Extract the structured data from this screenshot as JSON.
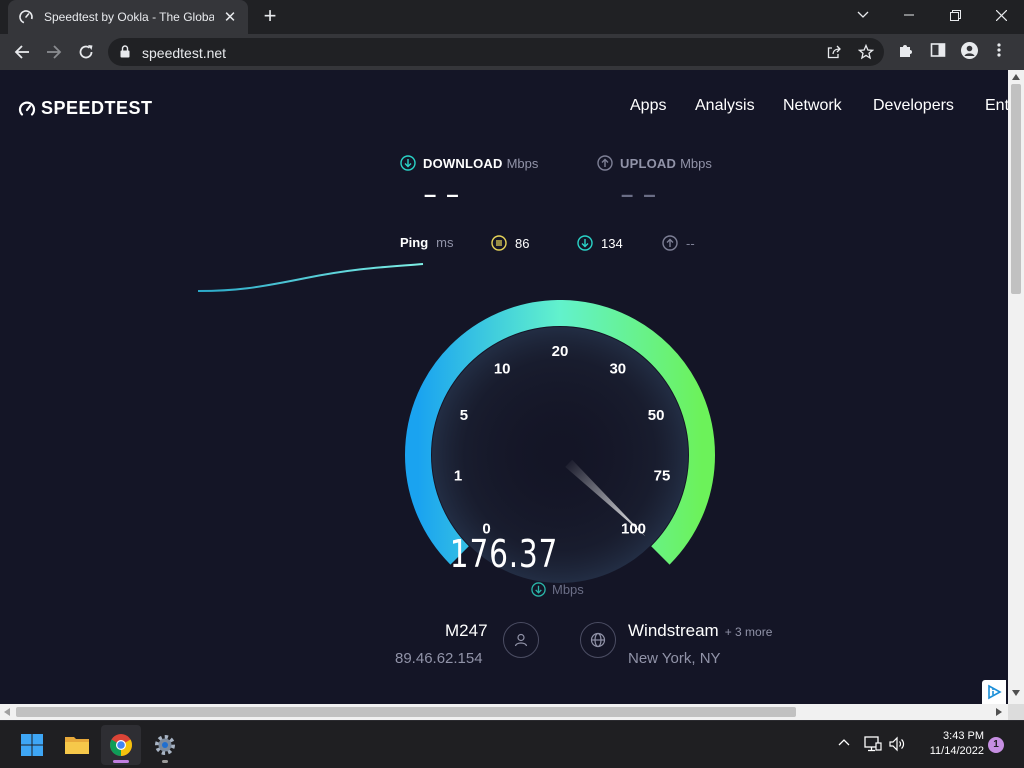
{
  "browser": {
    "tab_title": "Speedtest by Ookla - The Global Broadband Speed Test",
    "tab_close": "✕",
    "new_tab": "+",
    "url": "speedtest.net"
  },
  "site": {
    "logo": "SPEEDTEST",
    "nav": [
      "Apps",
      "Analysis",
      "Network",
      "Developers",
      "Ent"
    ]
  },
  "test": {
    "download_label": "DOWNLOAD",
    "download_unit": "Mbps",
    "download_value": "– –",
    "upload_label": "UPLOAD",
    "upload_unit": "Mbps",
    "upload_value": "– –",
    "ping_label": "Ping",
    "ping_unit": "ms",
    "ping_idle": "86",
    "ping_download": "134",
    "ping_upload": "--",
    "current_speed": "176.37",
    "current_unit": "Mbps",
    "gauge_fraction": 0.995
  },
  "gauge": {
    "ticks": [
      "0",
      "1",
      "5",
      "10",
      "20",
      "30",
      "50",
      "75",
      "100"
    ]
  },
  "connection": {
    "client_name": "M247",
    "client_ip": "89.46.62.154",
    "server_name": "Windstream",
    "server_more": "+ 3 more",
    "server_location": "New York, NY"
  },
  "taskbar": {
    "time": "3:43 PM",
    "date": "11/14/2022",
    "notifications": "1"
  },
  "colors": {
    "page_bg": "#141526",
    "gauge_start": "#1aa3f0",
    "gauge_mid": "#62f2cc",
    "gauge_end": "#6cf25a",
    "accent_teal": "#2ad4c8",
    "ping_yellow": "#e8d55a"
  }
}
